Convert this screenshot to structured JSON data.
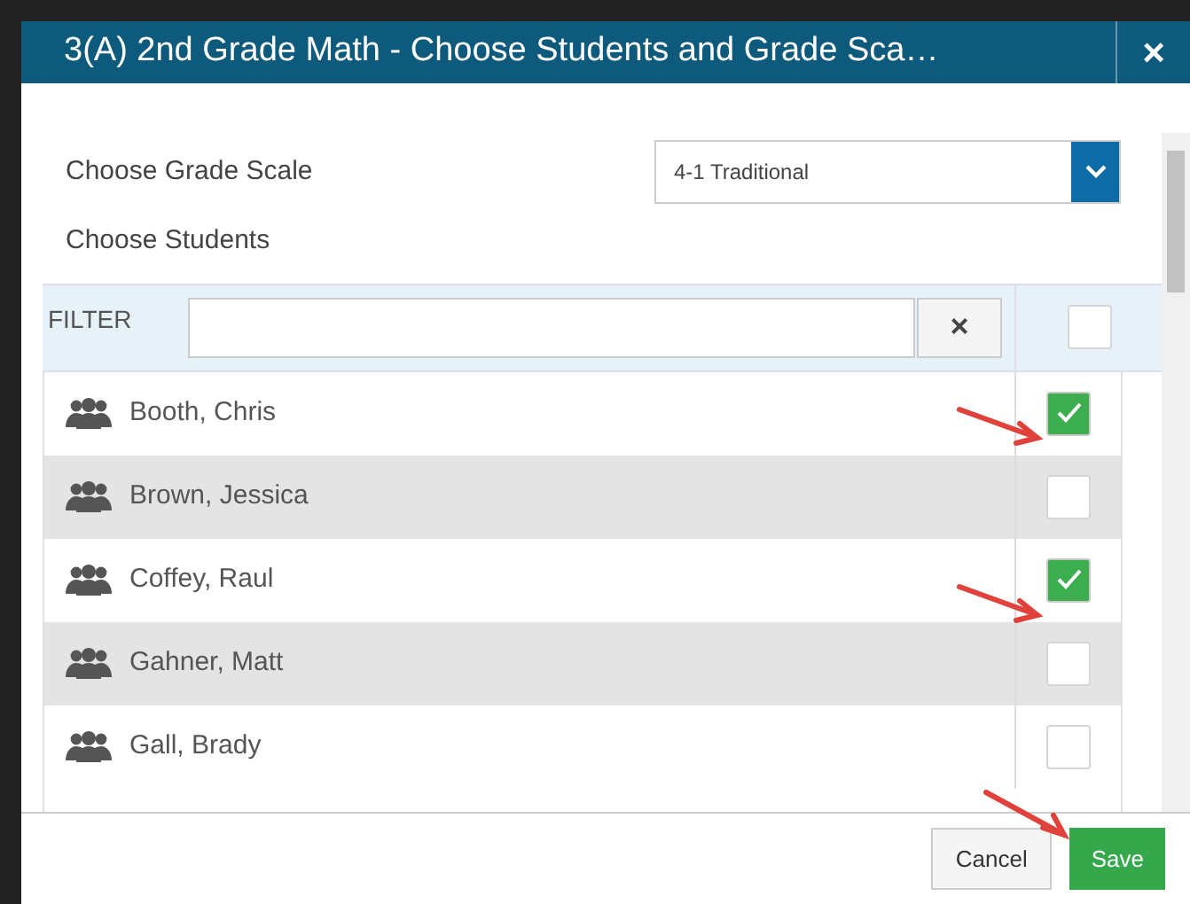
{
  "dialog": {
    "title": "3(A) 2nd Grade Math - Choose Students and Grade Sca…",
    "close": "×"
  },
  "grade_scale": {
    "label": "Choose Grade Scale",
    "value": "4-1 Traditional"
  },
  "students_label": "Choose Students",
  "filter": {
    "label": "FILTER",
    "clear": "×",
    "all_checked": false
  },
  "students": [
    {
      "name": "Booth, Chris",
      "checked": true
    },
    {
      "name": "Brown, Jessica",
      "checked": false
    },
    {
      "name": "Coffey, Raul",
      "checked": true
    },
    {
      "name": "Gahner, Matt",
      "checked": false
    },
    {
      "name": "Gall, Brady",
      "checked": false
    }
  ],
  "buttons": {
    "cancel": "Cancel",
    "save": "Save"
  }
}
